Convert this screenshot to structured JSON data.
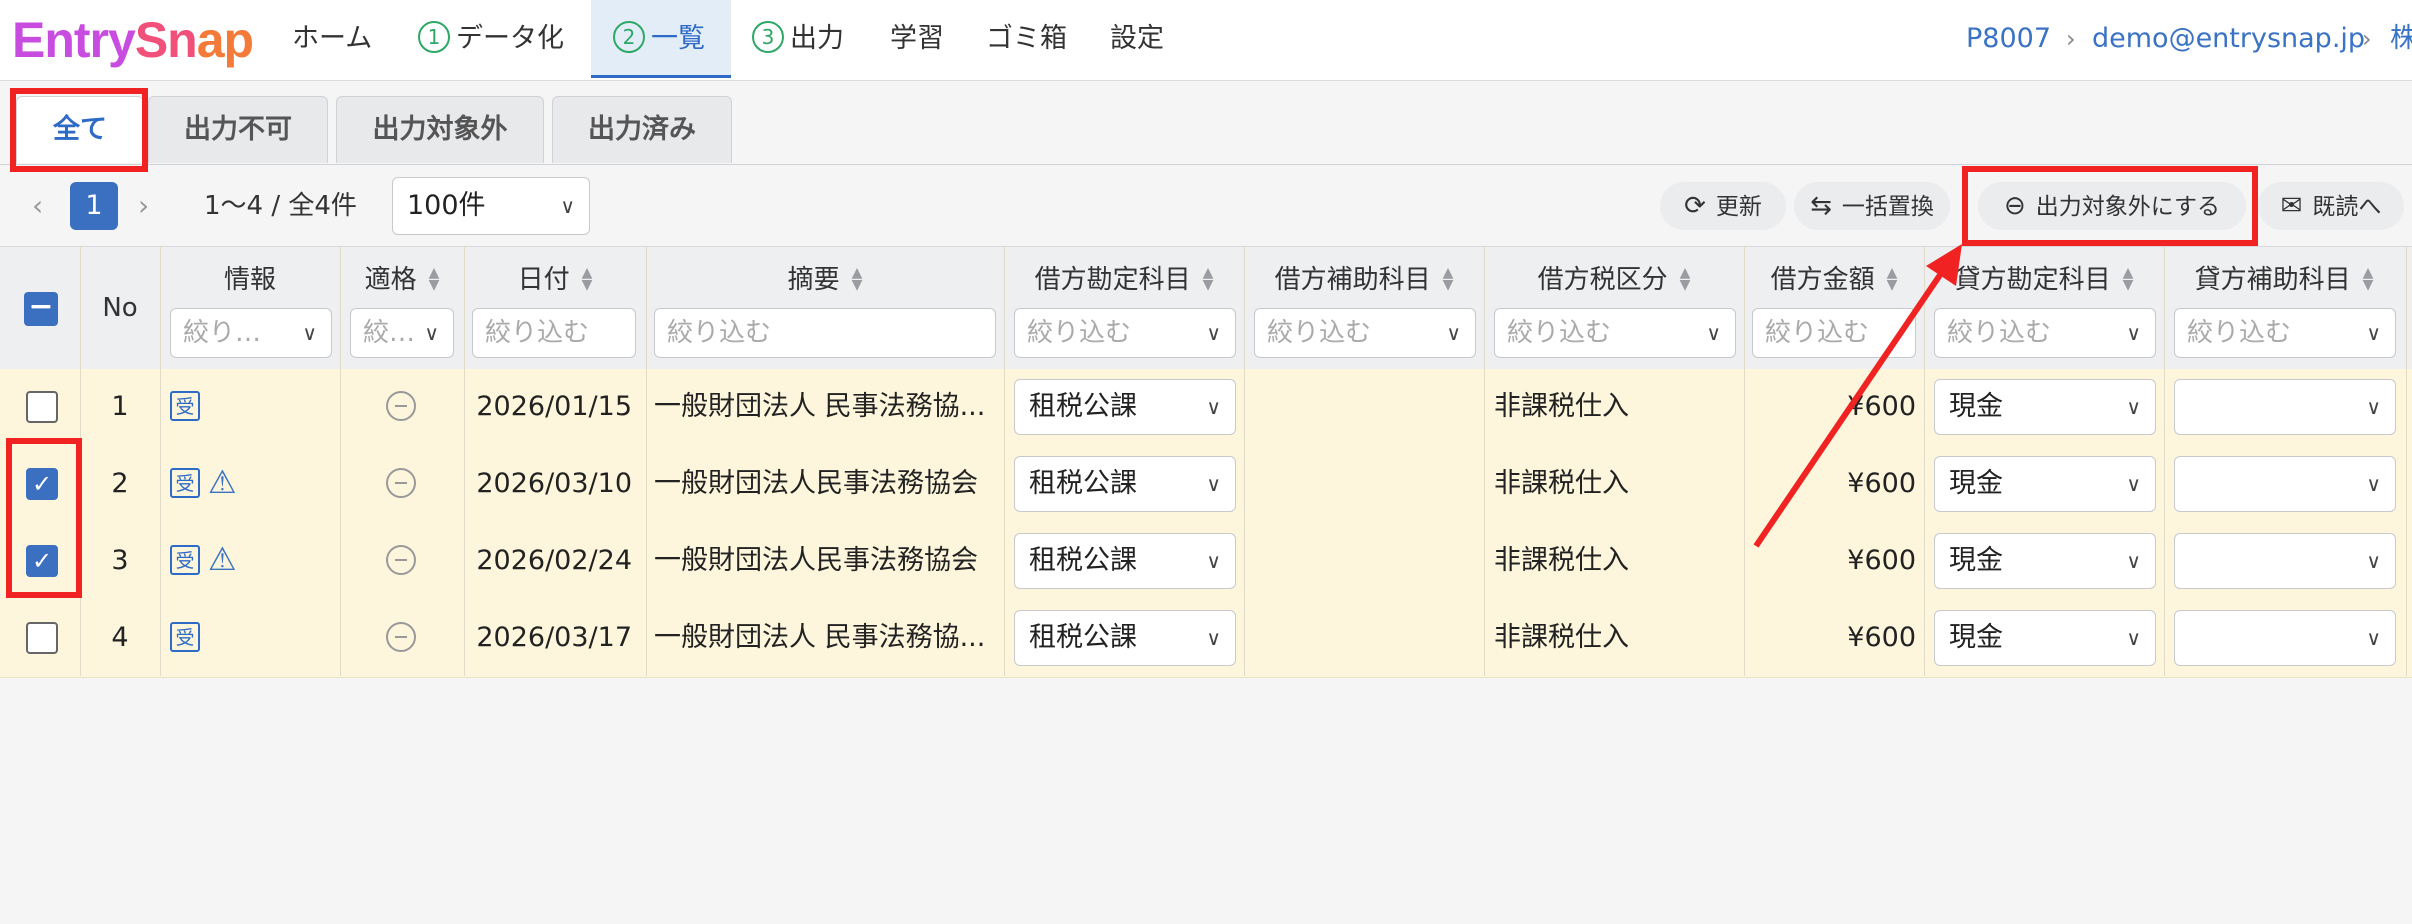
{
  "brand": {
    "part1": "Entry",
    "part2": "Sn",
    "part3": "ap"
  },
  "nav": {
    "home": "ホーム",
    "step1_num": "1",
    "step1": "データ化",
    "step2_num": "2",
    "step2": "一覧",
    "step3_num": "3",
    "step3": "出力",
    "learn": "学習",
    "trash": "ゴミ箱",
    "settings": "設定"
  },
  "breadcrumb": {
    "code": "P8007",
    "email": "demo@entrysnap.jp",
    "company_fragment": "株"
  },
  "tabs": [
    "全て",
    "出力不可",
    "出力対象外",
    "出力済み"
  ],
  "pagination": {
    "current": "1",
    "info": "1〜4 / 全4件",
    "per_page": "100件"
  },
  "toolbar": {
    "refresh": "更新",
    "bulk_replace": "一括置換",
    "exclude": "出力対象外にする",
    "read": "既読へ"
  },
  "columns": {
    "no": "No",
    "info": "情報",
    "validity": "適格",
    "date": "日付",
    "summary": "摘要",
    "debit_account": "借方勘定科目",
    "debit_sub": "借方補助科目",
    "debit_tax": "借方税区分",
    "debit_amount": "借方金額",
    "credit_account": "貸方勘定科目",
    "credit_sub": "貸方補助科目"
  },
  "filters": {
    "info": "絞り…",
    "validity": "絞…",
    "date": "絞り込む",
    "summary": "絞り込む",
    "debit_account": "絞り込む",
    "debit_sub": "絞り込む",
    "debit_tax": "絞り込む",
    "debit_amount": "絞り込む",
    "credit_account": "絞り込む",
    "credit_sub": "絞り込む"
  },
  "rows": [
    {
      "no": "1",
      "badge": "受",
      "warn": false,
      "checked": false,
      "date": "2026/01/15",
      "summary": "一般財団法人 民事法務協...",
      "debit_account": "租税公課",
      "debit_sub": "",
      "debit_tax": "非課税仕入",
      "debit_amount": "¥600",
      "credit_account": "現金",
      "credit_sub": ""
    },
    {
      "no": "2",
      "badge": "受",
      "warn": true,
      "checked": true,
      "date": "2026/03/10",
      "summary": "一般財団法人民事法務協会",
      "debit_account": "租税公課",
      "debit_sub": "",
      "debit_tax": "非課税仕入",
      "debit_amount": "¥600",
      "credit_account": "現金",
      "credit_sub": ""
    },
    {
      "no": "3",
      "badge": "受",
      "warn": true,
      "checked": true,
      "date": "2026/02/24",
      "summary": "一般財団法人民事法務協会",
      "debit_account": "租税公課",
      "debit_sub": "",
      "debit_tax": "非課税仕入",
      "debit_amount": "¥600",
      "credit_account": "現金",
      "credit_sub": ""
    },
    {
      "no": "4",
      "badge": "受",
      "warn": false,
      "checked": false,
      "date": "2026/03/17",
      "summary": "一般財団法人 民事法務協...",
      "debit_account": "租税公課",
      "debit_sub": "",
      "debit_tax": "非課税仕入",
      "debit_amount": "¥600",
      "credit_account": "現金",
      "credit_sub": ""
    }
  ],
  "colors": {
    "accent": "#3b6fbf",
    "annotation": "#f02222",
    "row_bg": "#fdf6dc",
    "step_green": "#2ea866"
  }
}
